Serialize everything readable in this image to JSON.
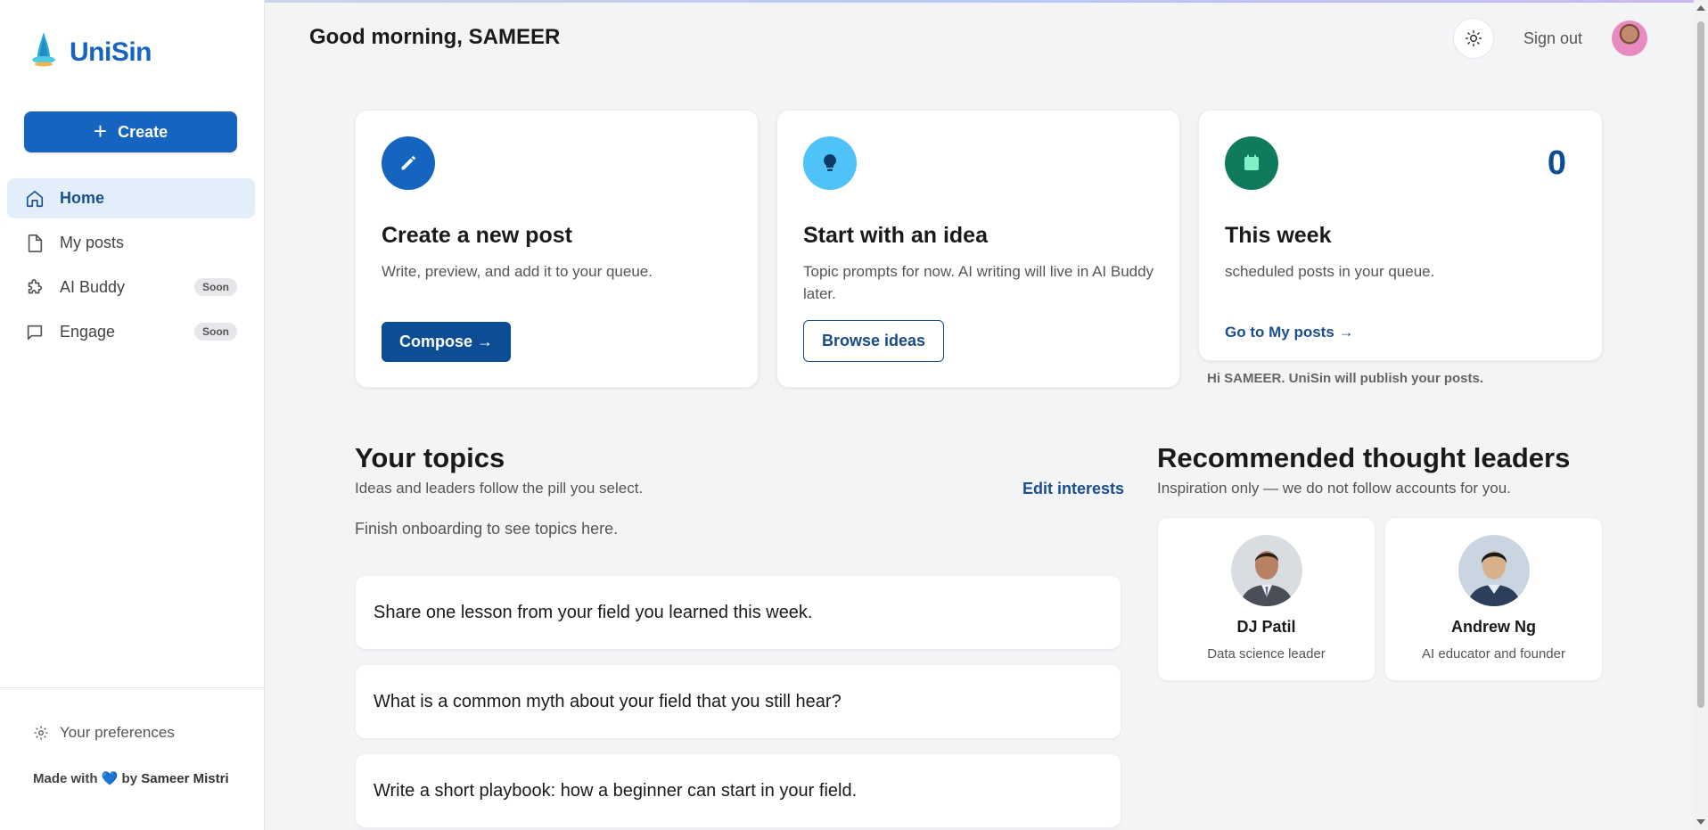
{
  "brand": {
    "name": "UniSin"
  },
  "sidebar": {
    "create_label": "Create",
    "items": [
      {
        "label": "Home",
        "icon": "home-icon",
        "active": true
      },
      {
        "label": "My posts",
        "icon": "document-icon"
      },
      {
        "label": "AI Buddy",
        "icon": "puzzle-icon",
        "badge": "Soon"
      },
      {
        "label": "Engage",
        "icon": "chat-icon",
        "badge": "Soon"
      }
    ],
    "preferences_label": "Your preferences",
    "made_with_prefix": "Made with",
    "made_with_by": "by",
    "made_with_author": "Sameer Mistri"
  },
  "header": {
    "greeting": "Good morning, SAMEER",
    "signout_label": "Sign out"
  },
  "cards": {
    "new_post": {
      "title": "Create a new post",
      "desc": "Write, preview, and add it to your queue.",
      "button": "Compose →"
    },
    "idea": {
      "title": "Start with an idea",
      "desc": "Topic prompts for now. AI writing will live in AI Buddy later.",
      "button": "Browse ideas"
    },
    "week": {
      "count": "0",
      "title": "This week",
      "desc": "scheduled posts in your queue.",
      "link": "Go to My posts →",
      "note": "Hi SAMEER. UniSin will publish your posts."
    }
  },
  "topics": {
    "title": "Your topics",
    "subtitle": "Ideas and leaders follow the pill you select.",
    "edit_label": "Edit interests",
    "empty_text": "Finish onboarding to see topics here.",
    "prompts": [
      "Share one lesson from your field you learned this week.",
      "What is a common myth about your field that you still hear?",
      "Write a short playbook: how a beginner can start in your field."
    ]
  },
  "leaders": {
    "title": "Recommended thought leaders",
    "subtitle": "Inspiration only — we do not follow accounts for you.",
    "people": [
      {
        "name": "DJ Patil",
        "role": "Data science leader"
      },
      {
        "name": "Andrew Ng",
        "role": "AI educator and founder"
      }
    ]
  },
  "colors": {
    "primary": "#1565c0",
    "dark_primary": "#0d4d94",
    "idea_icon_bg": "#4fc3f7",
    "week_icon_bg": "#0f7a5c"
  }
}
